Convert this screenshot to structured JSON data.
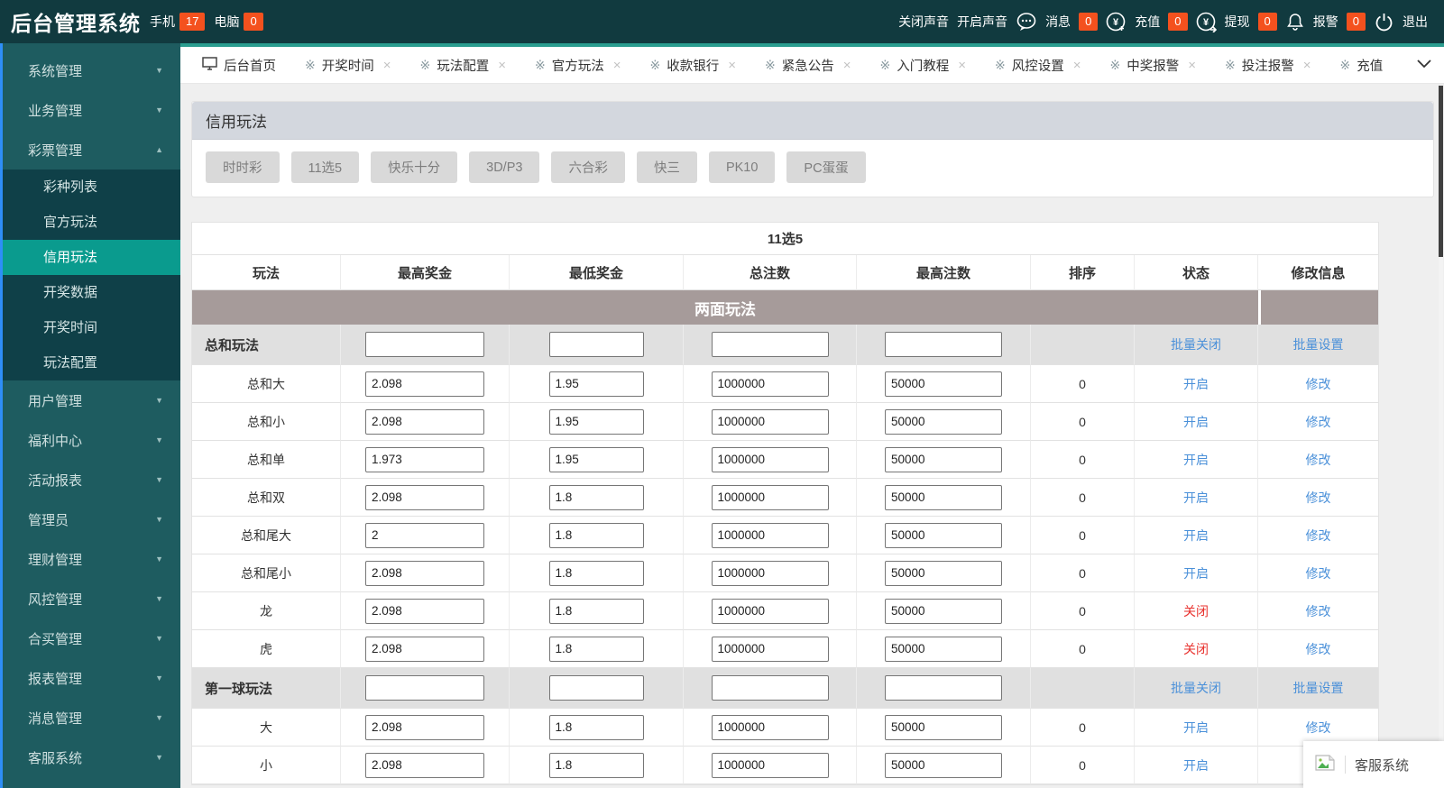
{
  "header": {
    "title": "后台管理系统",
    "phone_label": "手机",
    "phone_count": "17",
    "pc_label": "电脑",
    "pc_count": "0",
    "mute_label": "关闭声音",
    "unmute_label": "开启声音",
    "message_label": "消息",
    "message_count": "0",
    "message_icon": "speech-bubble-dots",
    "recharge_label": "充值",
    "recharge_count": "0",
    "recharge_icon": "yen-circle-plus",
    "withdraw_label": "提现",
    "withdraw_count": "0",
    "withdraw_icon": "yen-circle-arrow",
    "alarm_label": "报警",
    "alarm_count": "0",
    "alarm_icon": "bell",
    "logout_label": "退出",
    "logout_icon": "power",
    "badge_color": "#f4511e",
    "bg_color": "#113a3f"
  },
  "sidebar": {
    "bg_color": "#1e5c60",
    "submenu_bg": "#0f4048",
    "active_bg": "#0a9b8e",
    "edge_color": "#2e8ef7",
    "items": [
      {
        "key": "system-management",
        "label": "系统管理",
        "expanded": false
      },
      {
        "key": "business-management",
        "label": "业务管理",
        "expanded": false
      },
      {
        "key": "lottery-management",
        "label": "彩票管理",
        "expanded": true,
        "children": [
          {
            "key": "lottery-list",
            "label": "彩种列表",
            "active": false
          },
          {
            "key": "official-play",
            "label": "官方玩法",
            "active": false
          },
          {
            "key": "credit-play",
            "label": "信用玩法",
            "active": true
          },
          {
            "key": "draw-data",
            "label": "开奖数据",
            "active": false
          },
          {
            "key": "draw-time",
            "label": "开奖时间",
            "active": false
          },
          {
            "key": "play-config",
            "label": "玩法配置",
            "active": false
          }
        ]
      },
      {
        "key": "user-management",
        "label": "用户管理",
        "expanded": false
      },
      {
        "key": "welfare-center",
        "label": "福利中心",
        "expanded": false
      },
      {
        "key": "activity-report",
        "label": "活动报表",
        "expanded": false
      },
      {
        "key": "administrator",
        "label": "管理员",
        "expanded": false
      },
      {
        "key": "finance-management",
        "label": "理财管理",
        "expanded": false
      },
      {
        "key": "risk-management",
        "label": "风控管理",
        "expanded": false
      },
      {
        "key": "group-buy-management",
        "label": "合买管理",
        "expanded": false
      },
      {
        "key": "report-management",
        "label": "报表管理",
        "expanded": false
      },
      {
        "key": "message-management",
        "label": "消息管理",
        "expanded": false
      },
      {
        "key": "customer-service",
        "label": "客服系统",
        "expanded": false
      }
    ]
  },
  "tabs": {
    "accent_color": "#2a9d8f",
    "items": [
      {
        "key": "home",
        "label": "后台首页",
        "icon": "monitor",
        "closable": false
      },
      {
        "key": "draw-time",
        "label": "开奖时间",
        "icon": "dice",
        "closable": true
      },
      {
        "key": "play-config",
        "label": "玩法配置",
        "icon": "dice",
        "closable": true
      },
      {
        "key": "official-play",
        "label": "官方玩法",
        "icon": "dice",
        "closable": true
      },
      {
        "key": "bank",
        "label": "收款银行",
        "icon": "dice",
        "closable": true
      },
      {
        "key": "notice",
        "label": "紧急公告",
        "icon": "dice",
        "closable": true
      },
      {
        "key": "tutorial",
        "label": "入门教程",
        "icon": "dice",
        "closable": true
      },
      {
        "key": "risk-setting",
        "label": "风控设置",
        "icon": "dice",
        "closable": true
      },
      {
        "key": "win-alarm",
        "label": "中奖报警",
        "icon": "dice",
        "closable": true
      },
      {
        "key": "bet-alarm",
        "label": "投注报警",
        "icon": "dice",
        "closable": true
      },
      {
        "key": "recharge",
        "label": "充值",
        "icon": "dice",
        "closable": false
      }
    ],
    "overflow_icon": "chevron-down"
  },
  "panel": {
    "title": "信用玩法",
    "games": [
      {
        "key": "ssc",
        "label": "时时彩"
      },
      {
        "key": "11x5",
        "label": "11选5"
      },
      {
        "key": "klsf",
        "label": "快乐十分"
      },
      {
        "key": "3dp3",
        "label": "3D/P3"
      },
      {
        "key": "lhc",
        "label": "六合彩"
      },
      {
        "key": "k3",
        "label": "快三"
      },
      {
        "key": "pk10",
        "label": "PK10"
      },
      {
        "key": "pcdd",
        "label": "PC蛋蛋"
      }
    ]
  },
  "table": {
    "title": "11选5",
    "columns": [
      "玩法",
      "最高奖金",
      "最低奖金",
      "总注数",
      "最高注数",
      "排序",
      "状态",
      "修改信息"
    ],
    "section_title": "两面玩法",
    "section_color": "#a69b9a",
    "batch_close_label": "批量关闭",
    "batch_set_label": "批量设置",
    "status_open_label": "开启",
    "status_closed_label": "关闭",
    "modify_label": "修改",
    "link_color": "#4a90d9",
    "closed_color": "#e8312d",
    "groups": [
      {
        "key": "sum-play",
        "name": "总和玩法",
        "rows": [
          {
            "key": "sum-big",
            "label": "总和大",
            "max_prize": "2.098",
            "min_prize": "1.95",
            "total_bets": "1000000",
            "max_bets": "50000",
            "sort": "0",
            "status": "open"
          },
          {
            "key": "sum-small",
            "label": "总和小",
            "max_prize": "2.098",
            "min_prize": "1.95",
            "total_bets": "1000000",
            "max_bets": "50000",
            "sort": "0",
            "status": "open"
          },
          {
            "key": "sum-odd",
            "label": "总和单",
            "max_prize": "1.973",
            "min_prize": "1.95",
            "total_bets": "1000000",
            "max_bets": "50000",
            "sort": "0",
            "status": "open"
          },
          {
            "key": "sum-even",
            "label": "总和双",
            "max_prize": "2.098",
            "min_prize": "1.8",
            "total_bets": "1000000",
            "max_bets": "50000",
            "sort": "0",
            "status": "open"
          },
          {
            "key": "sum-tail-big",
            "label": "总和尾大",
            "max_prize": "2",
            "min_prize": "1.8",
            "total_bets": "1000000",
            "max_bets": "50000",
            "sort": "0",
            "status": "open"
          },
          {
            "key": "sum-tail-small",
            "label": "总和尾小",
            "max_prize": "2.098",
            "min_prize": "1.8",
            "total_bets": "1000000",
            "max_bets": "50000",
            "sort": "0",
            "status": "open"
          },
          {
            "key": "dragon",
            "label": "龙",
            "max_prize": "2.098",
            "min_prize": "1.8",
            "total_bets": "1000000",
            "max_bets": "50000",
            "sort": "0",
            "status": "closed"
          },
          {
            "key": "tiger",
            "label": "虎",
            "max_prize": "2.098",
            "min_prize": "1.8",
            "total_bets": "1000000",
            "max_bets": "50000",
            "sort": "0",
            "status": "closed"
          }
        ]
      },
      {
        "key": "first-ball-play",
        "name": "第一球玩法",
        "rows": [
          {
            "key": "big",
            "label": "大",
            "max_prize": "2.098",
            "min_prize": "1.8",
            "total_bets": "1000000",
            "max_bets": "50000",
            "sort": "0",
            "status": "open"
          },
          {
            "key": "small",
            "label": "小",
            "max_prize": "2.098",
            "min_prize": "1.8",
            "total_bets": "1000000",
            "max_bets": "50000",
            "sort": "0",
            "status": "open"
          }
        ]
      }
    ]
  },
  "widget": {
    "label": "客服系统",
    "icon": "broken-image"
  }
}
